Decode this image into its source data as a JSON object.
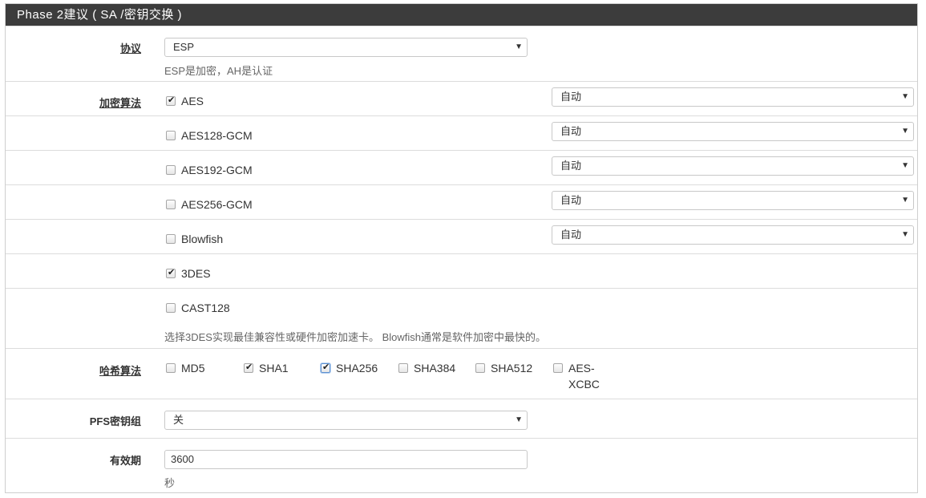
{
  "panel": {
    "title": "Phase 2建议 ( SA /密钥交换 )"
  },
  "protocol": {
    "label": "协议",
    "value": "ESP",
    "help": "ESP是加密，AH是认证"
  },
  "encryption": {
    "label": "加密算法",
    "items": [
      {
        "name": "AES",
        "checked": true,
        "keylen": "自动"
      },
      {
        "name": "AES128-GCM",
        "checked": false,
        "keylen": "自动"
      },
      {
        "name": "AES192-GCM",
        "checked": false,
        "keylen": "自动"
      },
      {
        "name": "AES256-GCM",
        "checked": false,
        "keylen": "自动"
      },
      {
        "name": "Blowfish",
        "checked": false,
        "keylen": "自动"
      },
      {
        "name": "3DES",
        "checked": true
      },
      {
        "name": "CAST128",
        "checked": false
      }
    ],
    "help": "选择3DES实现最佳兼容性或硬件加密加速卡。 Blowfish通常是软件加密中最快的。"
  },
  "hash": {
    "label": "哈希算法",
    "items": [
      {
        "name": "MD5",
        "checked": false
      },
      {
        "name": "SHA1",
        "checked": true
      },
      {
        "name": "SHA256",
        "checked": true
      },
      {
        "name": "SHA384",
        "checked": false
      },
      {
        "name": "SHA512",
        "checked": false
      },
      {
        "name": "AES-",
        "name2": "XCBC",
        "checked": false
      }
    ]
  },
  "pfs": {
    "label": "PFS密钥组",
    "value": "关"
  },
  "lifetime": {
    "label": "有效期",
    "value": "3600",
    "help": "秒"
  },
  "icons": {
    "caret": "▼",
    "check": "✔"
  }
}
